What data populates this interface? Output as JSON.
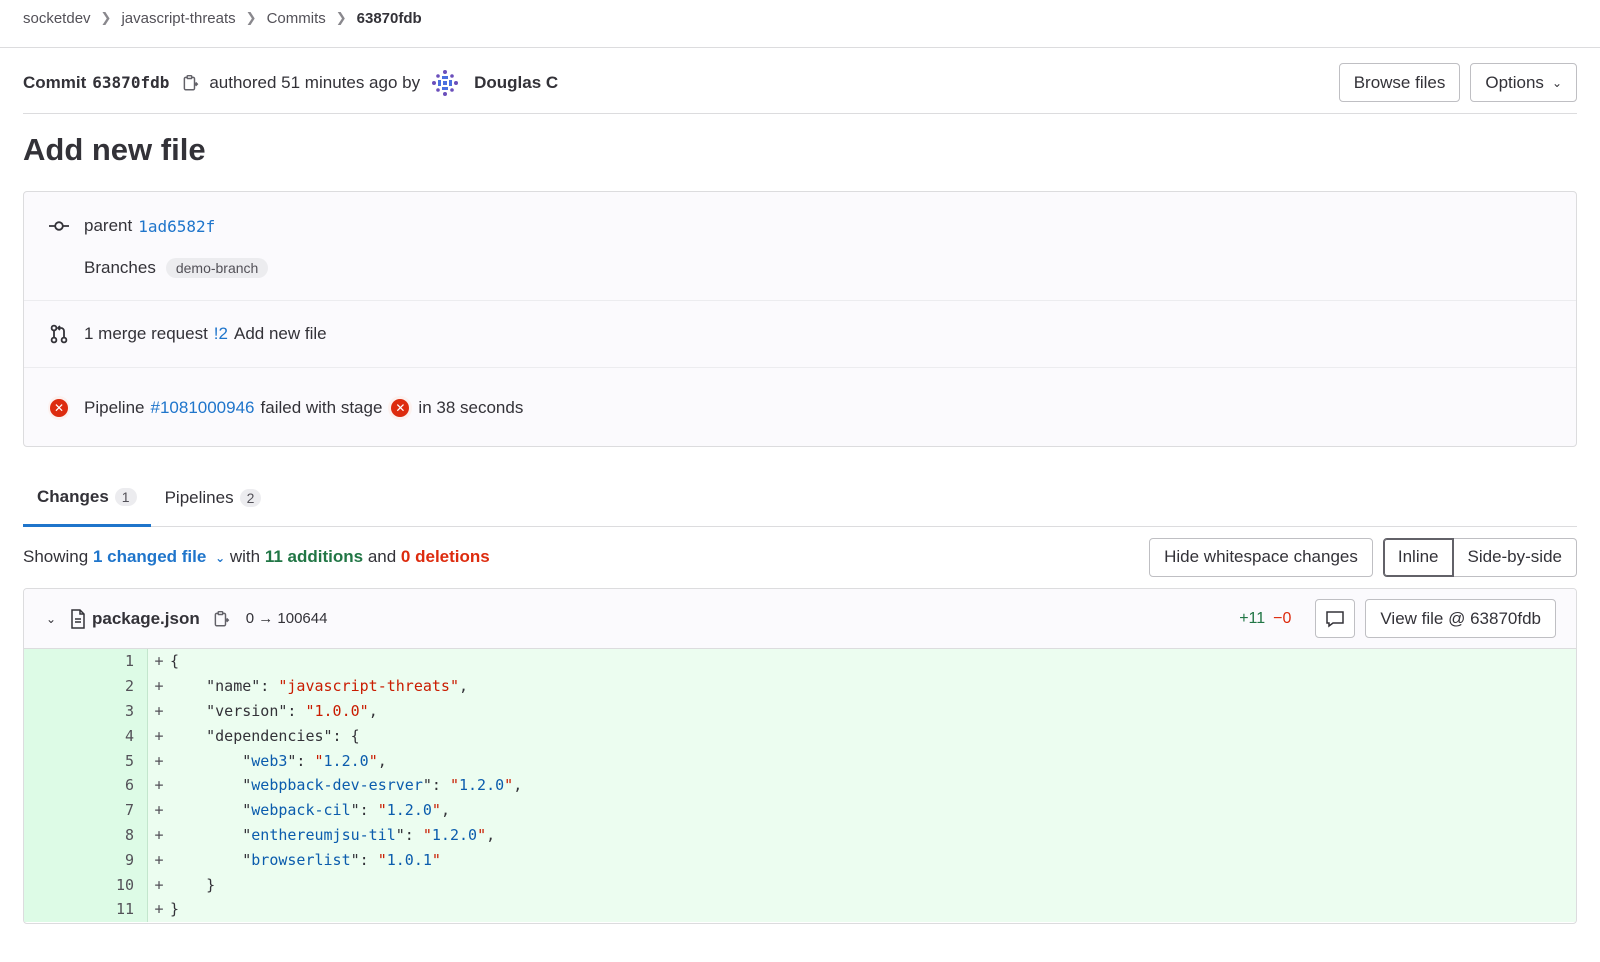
{
  "breadcrumb": {
    "items": [
      "socketdev",
      "javascript-threats",
      "Commits"
    ],
    "current": "63870fdb"
  },
  "commit": {
    "label": "Commit",
    "sha": "63870fdb",
    "authored_text": "authored 51 minutes ago by",
    "author": "Douglas C",
    "browse_label": "Browse files",
    "options_label": "Options"
  },
  "title": "Add new file",
  "info": {
    "parent_label": "parent",
    "parent_sha": "1ad6582f",
    "branches_label": "Branches",
    "branch": "demo-branch",
    "mr_text": "1 merge request",
    "mr_link": "!2",
    "mr_title": "Add new file",
    "pipeline_label": "Pipeline",
    "pipeline_link": "#1081000946",
    "pipeline_status_text": "failed with stage",
    "pipeline_duration": "in 38 seconds"
  },
  "tabs": [
    {
      "label": "Changes",
      "count": "1"
    },
    {
      "label": "Pipelines",
      "count": "2"
    }
  ],
  "changes": {
    "showing": "Showing",
    "files_link": "1 changed file",
    "with": "with",
    "additions": "11 additions",
    "and": "and",
    "deletions": "0 deletions",
    "hide_ws_label": "Hide whitespace changes",
    "inline_label": "Inline",
    "side_label": "Side-by-side"
  },
  "file": {
    "name": "package.json",
    "mode": "0 → 100644",
    "plus": "+11",
    "minus": "−0",
    "view_label": "View file @ 63870fdb"
  },
  "colors": {
    "link": "#1f75cb",
    "added_bg": "#ecfdf0",
    "additions": "#217645",
    "deletions": "#dd2b0e",
    "failed": "#dd2b0e"
  },
  "diff_lines": [
    {
      "n": "1",
      "sign": "+",
      "parts": [
        [
          "p",
          "{"
        ]
      ]
    },
    {
      "n": "2",
      "sign": "+",
      "parts": [
        [
          "p",
          "    \"name\": "
        ],
        [
          "s",
          "\"javascript-threats\""
        ],
        [
          "p",
          ","
        ]
      ]
    },
    {
      "n": "3",
      "sign": "+",
      "parts": [
        [
          "p",
          "    \"version\": "
        ],
        [
          "s",
          "\"1.0.0\""
        ],
        [
          "p",
          ","
        ]
      ]
    },
    {
      "n": "4",
      "sign": "+",
      "parts": [
        [
          "p",
          "    \"dependencies\": {"
        ]
      ]
    },
    {
      "n": "5",
      "sign": "+",
      "parts": [
        [
          "p",
          "        \""
        ],
        [
          "k",
          "web3"
        ],
        [
          "p",
          "\": "
        ],
        [
          "s",
          "\""
        ],
        [
          "v",
          "1.2.0"
        ],
        [
          "s",
          "\""
        ],
        [
          "p",
          ","
        ]
      ]
    },
    {
      "n": "6",
      "sign": "+",
      "parts": [
        [
          "p",
          "        \""
        ],
        [
          "k",
          "webpback-dev-esrver"
        ],
        [
          "p",
          "\": "
        ],
        [
          "s",
          "\""
        ],
        [
          "v",
          "1.2.0"
        ],
        [
          "s",
          "\""
        ],
        [
          "p",
          ","
        ]
      ]
    },
    {
      "n": "7",
      "sign": "+",
      "parts": [
        [
          "p",
          "        \""
        ],
        [
          "k",
          "webpack-cil"
        ],
        [
          "p",
          "\": "
        ],
        [
          "s",
          "\""
        ],
        [
          "v",
          "1.2.0"
        ],
        [
          "s",
          "\""
        ],
        [
          "p",
          ","
        ]
      ]
    },
    {
      "n": "8",
      "sign": "+",
      "parts": [
        [
          "p",
          "        \""
        ],
        [
          "k",
          "enthereumjsu-til"
        ],
        [
          "p",
          "\": "
        ],
        [
          "s",
          "\""
        ],
        [
          "v",
          "1.2.0"
        ],
        [
          "s",
          "\""
        ],
        [
          "p",
          ","
        ]
      ]
    },
    {
      "n": "9",
      "sign": "+",
      "parts": [
        [
          "p",
          "        \""
        ],
        [
          "k",
          "browserlist"
        ],
        [
          "p",
          "\": "
        ],
        [
          "s",
          "\""
        ],
        [
          "v",
          "1.0.1"
        ],
        [
          "s",
          "\""
        ]
      ]
    },
    {
      "n": "10",
      "sign": "+",
      "parts": [
        [
          "p",
          "    }"
        ]
      ]
    },
    {
      "n": "11",
      "sign": "+",
      "parts": [
        [
          "p",
          "}"
        ]
      ]
    }
  ]
}
